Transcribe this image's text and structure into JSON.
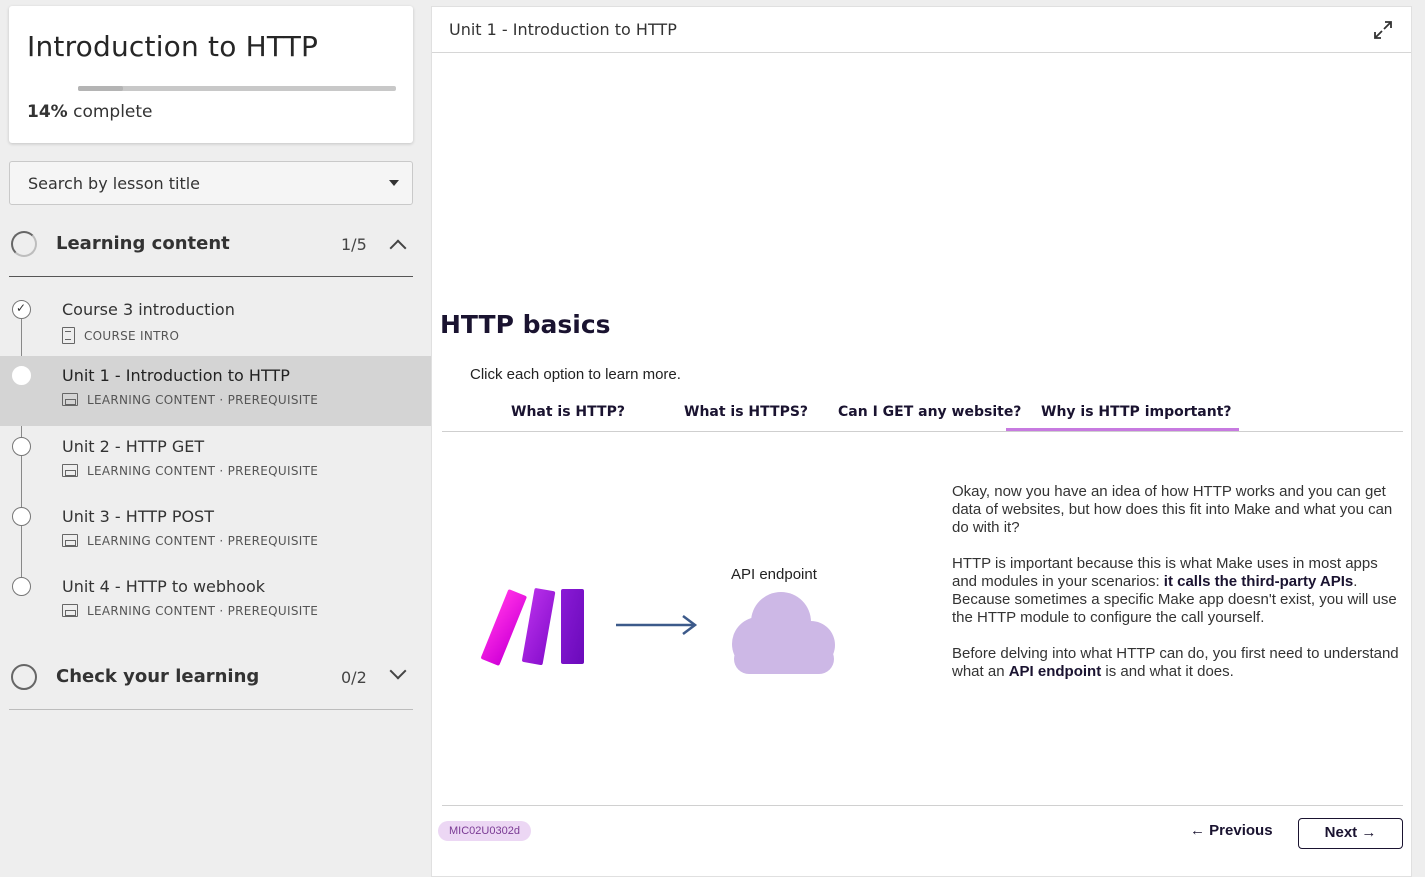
{
  "course": {
    "title": "Introduction to HTTP",
    "progress_percent": 14,
    "progress_value": "14%",
    "progress_suffix": " complete"
  },
  "search": {
    "label": "Search by lesson title"
  },
  "sections": [
    {
      "title": "Learning content",
      "count": "1/5",
      "expanded": true
    },
    {
      "title": "Check your learning",
      "count": "0/2",
      "expanded": false
    }
  ],
  "lessons": [
    {
      "title": "Course 3 introduction",
      "meta": "COURSE INTRO",
      "completed": true,
      "icon": "document-icon"
    },
    {
      "title": "Unit 1 - Introduction to HTTP",
      "meta": "LEARNING CONTENT · PREREQUISITE",
      "active": true,
      "icon": "screen-icon"
    },
    {
      "title": "Unit 2 - HTTP GET",
      "meta": "LEARNING CONTENT · PREREQUISITE",
      "icon": "screen-icon"
    },
    {
      "title": "Unit 3 - HTTP POST",
      "meta": "LEARNING CONTENT · PREREQUISITE",
      "icon": "screen-icon"
    },
    {
      "title": "Unit 4 - HTTP to webhook",
      "meta": "LEARNING CONTENT · PREREQUISITE",
      "icon": "screen-icon"
    }
  ],
  "main": {
    "header_title": "Unit 1 - Introduction to HTTP",
    "heading": "HTTP basics",
    "instruction": "Click each option to learn more.",
    "tabs": [
      {
        "label": "What is HTTP?"
      },
      {
        "label": "What is HTTPS?"
      },
      {
        "label": "Can I GET any website?"
      },
      {
        "label": "Why is HTTP important?",
        "active": true
      }
    ],
    "illustration": {
      "api_label": "API endpoint"
    },
    "description": {
      "p1": "Okay, now you have an idea of how HTTP works and you can get data of websites, but how does this fit into Make and what you can do with it?",
      "p2_a": "HTTP is important because this is what Make uses in most apps and modules in your scenarios: ",
      "p2_b": "it calls the third-party APIs",
      "p2_c": ". Because sometimes a specific Make app doesn't exist, you will use the HTTP module to configure the call yourself.",
      "p3_a": "Before delving into what HTTP can do, you first need to understand what an ",
      "p3_b": "API endpoint",
      "p3_c": " is and what it does."
    },
    "footer": {
      "code": "MIC02U0302d",
      "previous_label": "Previous",
      "next_label": "Next"
    }
  },
  "colors": {
    "accent_purple": "#c77ae0",
    "dark_text": "#1a1330",
    "badge_bg": "#ecd7f4",
    "cloud": "#cdb8e6",
    "arrow": "#3c5a8a"
  }
}
